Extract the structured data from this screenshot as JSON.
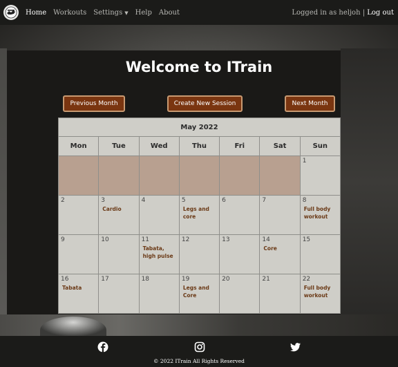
{
  "nav": {
    "home": "Home",
    "workouts": "Workouts",
    "settings": "Settings",
    "help": "Help",
    "about": "About",
    "logged_in": "Logged in as heljoh",
    "separator": "|",
    "logout": "Log out"
  },
  "main": {
    "title": "Welcome to ITrain",
    "prev_button": "Previous Month",
    "create_button": "Create New Session",
    "next_button": "Next Month"
  },
  "calendar": {
    "month": "May 2022",
    "weekdays": [
      "Mon",
      "Tue",
      "Wed",
      "Thu",
      "Fri",
      "Sat",
      "Sun"
    ],
    "days": [
      {
        "day": "",
        "session": ""
      },
      {
        "day": "",
        "session": ""
      },
      {
        "day": "",
        "session": ""
      },
      {
        "day": "",
        "session": ""
      },
      {
        "day": "",
        "session": ""
      },
      {
        "day": "",
        "session": ""
      },
      {
        "day": "1",
        "session": ""
      },
      {
        "day": "2",
        "session": ""
      },
      {
        "day": "3",
        "session": "Cardio"
      },
      {
        "day": "4",
        "session": ""
      },
      {
        "day": "5",
        "session": "Legs and core"
      },
      {
        "day": "6",
        "session": ""
      },
      {
        "day": "7",
        "session": ""
      },
      {
        "day": "8",
        "session": "Full body workout"
      },
      {
        "day": "9",
        "session": ""
      },
      {
        "day": "10",
        "session": ""
      },
      {
        "day": "11",
        "session": "Tabata, high pulse"
      },
      {
        "day": "12",
        "session": ""
      },
      {
        "day": "13",
        "session": ""
      },
      {
        "day": "14",
        "session": "Core"
      },
      {
        "day": "15",
        "session": ""
      },
      {
        "day": "16",
        "session": "Tabata"
      },
      {
        "day": "17",
        "session": ""
      },
      {
        "day": "18",
        "session": ""
      },
      {
        "day": "19",
        "session": "Legs and Core"
      },
      {
        "day": "20",
        "session": ""
      },
      {
        "day": "21",
        "session": ""
      },
      {
        "day": "22",
        "session": "Full body workout"
      }
    ]
  },
  "footer": {
    "icons": [
      "facebook-icon",
      "instagram-icon",
      "twitter-icon"
    ],
    "copyright": "© 2022   ITrain   All Rights Reserved"
  },
  "colors": {
    "button_bg": "#7a3510",
    "empty_cell": "#b8a090",
    "session_text": "#6b3a17"
  }
}
